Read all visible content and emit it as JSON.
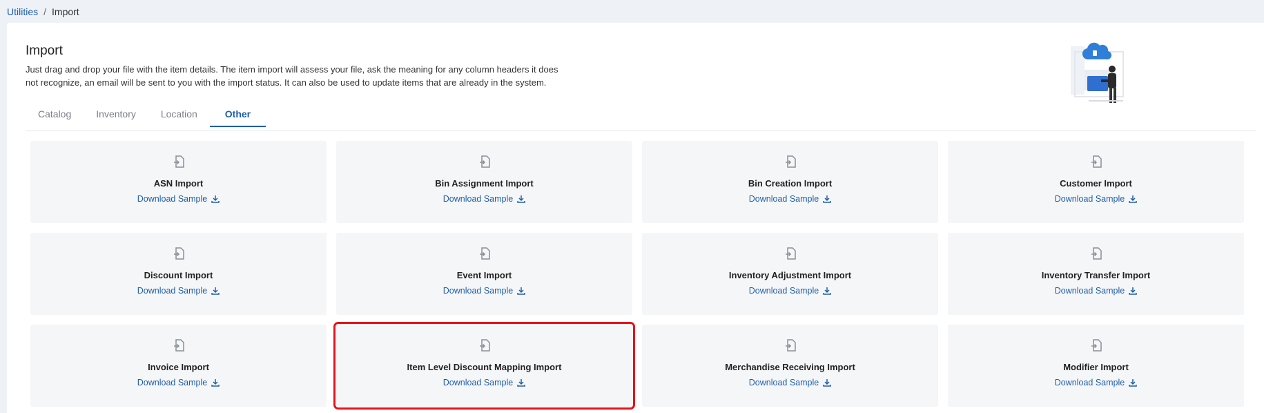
{
  "breadcrumb": {
    "parent": "Utilities",
    "separator": "/",
    "current": "Import"
  },
  "page": {
    "title": "Import",
    "description": "Just drag and drop your file with the item details. The item import will assess your file, ask the meaning for any column headers it does not recognize, an email will be sent to you with the import status. It can also be used to update items that are already in the system."
  },
  "tabs": [
    {
      "label": "Catalog"
    },
    {
      "label": "Inventory"
    },
    {
      "label": "Location"
    },
    {
      "label": "Other",
      "active": true
    }
  ],
  "download_label": "Download Sample",
  "cards": [
    {
      "title": "ASN Import",
      "download": "Download Sample"
    },
    {
      "title": "Bin Assignment Import",
      "download": "Download Sample"
    },
    {
      "title": "Bin Creation Import",
      "download": "Download Sample"
    },
    {
      "title": "Customer Import",
      "download": "Download Sample"
    },
    {
      "title": "Discount Import",
      "download": "Download Sample"
    },
    {
      "title": "Event Import",
      "download": "Download Sample"
    },
    {
      "title": "Inventory Adjustment Import",
      "download": "Download Sample"
    },
    {
      "title": "Inventory Transfer Import",
      "download": "Download Sample"
    },
    {
      "title": "Invoice Import",
      "download": "Download Sample"
    },
    {
      "title": "Item Level Discount Mapping Import",
      "download": "Download Sample",
      "highlighted": true
    },
    {
      "title": "Merchandise Receiving Import",
      "download": "Download Sample"
    },
    {
      "title": "Modifier Import",
      "download": "Download Sample"
    }
  ],
  "icons": {
    "card": "file-import-icon",
    "download": "download-icon"
  },
  "colors": {
    "accent": "#1f5fa8",
    "highlight": "#e3121b",
    "card_bg": "#f5f6f8"
  }
}
